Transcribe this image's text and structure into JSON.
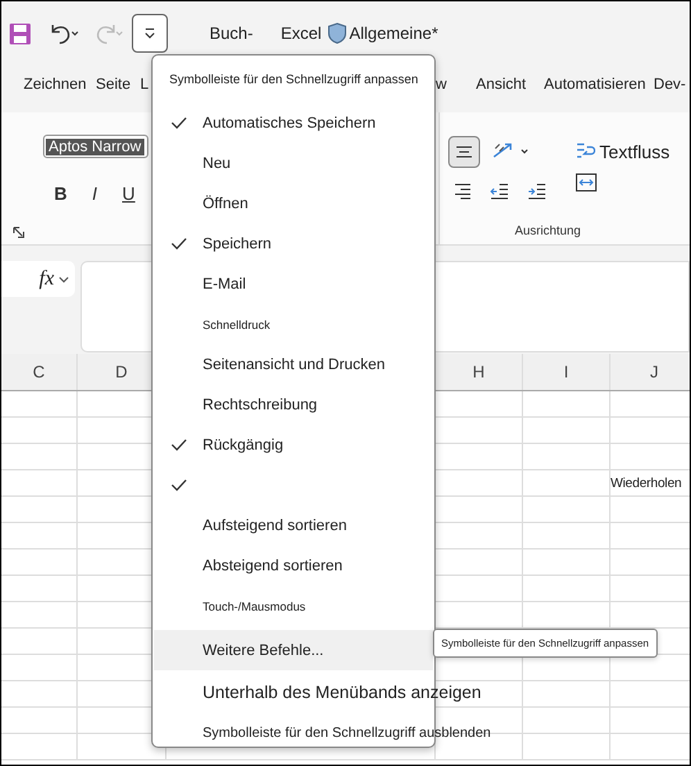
{
  "title_bar": {
    "quick_access_expanded": true,
    "redo_disabled": true,
    "document_title": "Buch-",
    "app_name": "Excel",
    "sensitivity_label": "Allgemeine*"
  },
  "ribbon_tabs": [
    "Zeichnen",
    "Seite",
    "L",
    "w",
    "Ansicht",
    "Automatisieren",
    "Dev-"
  ],
  "ribbon": {
    "font_field": {
      "value": "Aptos Narrow"
    },
    "format_buttons": [
      "B",
      "I",
      "U"
    ],
    "align_center": {
      "selected": true
    },
    "wrap_text": "Textfluss",
    "group_label": "Ausrichtung"
  },
  "formula_bar": {
    "function_label": "fx"
  },
  "columns_left": [
    "C",
    "D"
  ],
  "columns_right": [
    "H",
    "I",
    "J"
  ],
  "cell_text": "Wiederholen",
  "menu": {
    "title": "Symbolleiste für den Schnellzugriff anpassen",
    "items": [
      {
        "label": "Automatisches Speichern",
        "checked": true,
        "kind": "normal"
      },
      {
        "label": "Neu",
        "checked": false,
        "kind": "normal"
      },
      {
        "label": "Öffnen",
        "checked": false,
        "kind": "normal"
      },
      {
        "label": "Speichern",
        "checked": true,
        "kind": "normal"
      },
      {
        "label": "E-Mail",
        "checked": false,
        "kind": "normal"
      },
      {
        "label": "Schnelldruck",
        "checked": false,
        "kind": "small"
      },
      {
        "label": "Seitenansicht und Drucken",
        "checked": false,
        "kind": "normal"
      },
      {
        "label": "Rechtschreibung",
        "checked": false,
        "kind": "normal"
      },
      {
        "label": "Rückgängig",
        "checked": true,
        "kind": "normal"
      },
      {
        "checked": true,
        "kind": "normal"
      },
      {
        "label": "Aufsteigend sortieren",
        "checked": false,
        "kind": "normal"
      },
      {
        "label": "Absteigend sortieren",
        "checked": false,
        "kind": "normal"
      },
      {
        "label": "Touch-/Mausmodus",
        "checked": false,
        "kind": "small"
      },
      {
        "label": "Weitere Befehle...",
        "checked": false,
        "kind": "normal",
        "divider_before": true,
        "highlighted": true
      },
      {
        "label": "Unterhalb des Menübands anzeigen",
        "checked": false,
        "kind": "large"
      },
      {
        "label": "Symbolleiste für den Schnellzugriff ausblenden",
        "checked": false,
        "kind": "medium"
      }
    ]
  },
  "tooltip": "Symbolleiste für  den Schnellzugriff anpassen"
}
